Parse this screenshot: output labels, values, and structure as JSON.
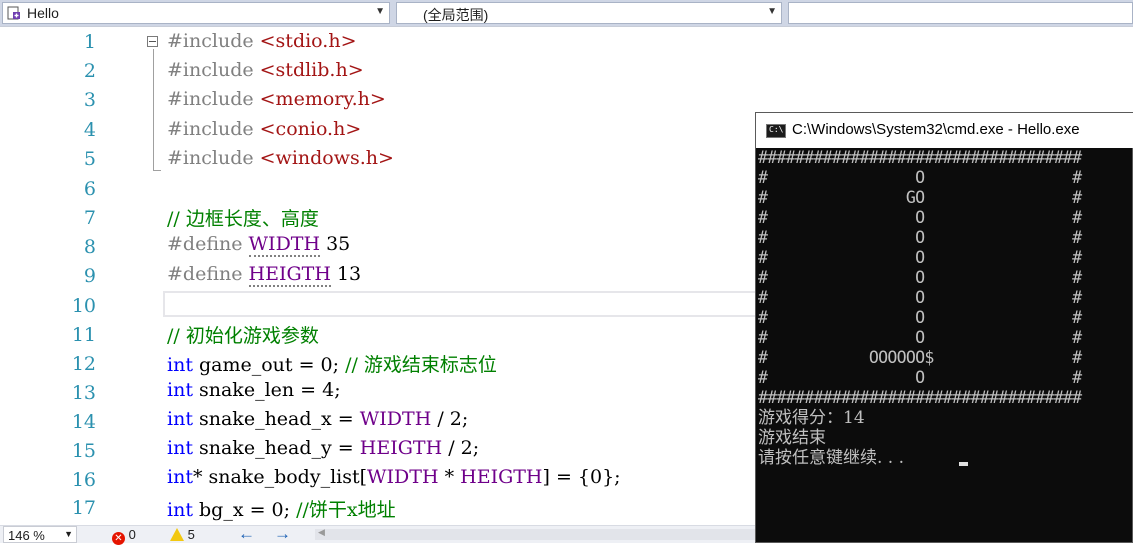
{
  "navbar": {
    "project": "Hello",
    "scope": "(全局范围)",
    "member": ""
  },
  "editor": {
    "line_numbers": [
      "1",
      "2",
      "3",
      "4",
      "5",
      "6",
      "7",
      "8",
      "9",
      "10",
      "11",
      "12",
      "13",
      "14",
      "15",
      "16",
      "17"
    ],
    "lines": {
      "l1": [
        "#include ",
        "<stdio.h>"
      ],
      "l2": [
        "#include ",
        "<stdlib.h>"
      ],
      "l3": [
        "#include ",
        "<memory.h>"
      ],
      "l4": [
        "#include ",
        "<conio.h>"
      ],
      "l5": [
        "#include ",
        "<windows.h>"
      ],
      "l7": "// 边框长度、高度",
      "l8": [
        "#define ",
        "WIDTH",
        " 35"
      ],
      "l9": [
        "#define ",
        "HEIGTH",
        " 13"
      ],
      "l11": "// 初始化游戏参数",
      "l12": [
        "int",
        " game_out = 0; ",
        "// 游戏结束标志位"
      ],
      "l13": [
        "int",
        " snake_len = 4;"
      ],
      "l14": [
        "int",
        " snake_head_x = ",
        "WIDTH",
        " / 2;"
      ],
      "l15": [
        "int",
        " snake_head_y = ",
        "HEIGTH",
        " / 2;"
      ],
      "l16": [
        "int",
        "* snake_body_list[",
        "WIDTH",
        " * ",
        "HEIGTH",
        "] = {0};"
      ],
      "l17": [
        "int",
        " bg_x = 0; ",
        "//饼干x地址"
      ]
    }
  },
  "console": {
    "title": "C:\\Windows\\System32\\cmd.exe - Hello.exe",
    "icon_label": "C:\\",
    "grid": [
      "###################################",
      "#                O                #",
      "#               GO                #",
      "#                O                #",
      "#                O                #",
      "#                O                #",
      "#                O                #",
      "#                O                #",
      "#                O                #",
      "#                O                #",
      "#           OOOOOO$               #",
      "#                O                #",
      "###################################"
    ],
    "score_line": "游戏得分：14",
    "end_line": "游戏结束",
    "prompt_line": "请按任意键继续. . ."
  },
  "status": {
    "zoom": "146 %",
    "errors": "0",
    "warnings": "5"
  },
  "colors": {
    "keyword": "#0000ff",
    "preprocessor": "#808080",
    "string": "#a31515",
    "macro": "#6f008a",
    "comment": "#008000",
    "line_number": "#2b91af",
    "console_bg": "#0c0c0c"
  }
}
